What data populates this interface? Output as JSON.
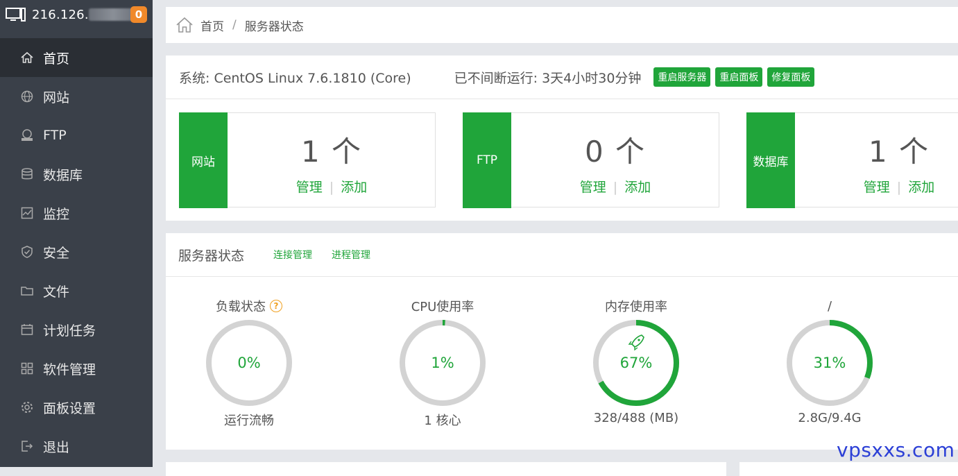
{
  "sidebar": {
    "server_ip": "216.126.",
    "notification_count": "0",
    "items": [
      {
        "label": "首页",
        "icon": "home-icon",
        "active": true
      },
      {
        "label": "网站",
        "icon": "globe-icon"
      },
      {
        "label": "FTP",
        "icon": "ftp-icon"
      },
      {
        "label": "数据库",
        "icon": "database-icon"
      },
      {
        "label": "监控",
        "icon": "monitor-icon"
      },
      {
        "label": "安全",
        "icon": "shield-icon"
      },
      {
        "label": "文件",
        "icon": "folder-icon"
      },
      {
        "label": "计划任务",
        "icon": "calendar-icon"
      },
      {
        "label": "软件管理",
        "icon": "apps-grid-icon"
      },
      {
        "label": "面板设置",
        "icon": "gear-icon"
      },
      {
        "label": "退出",
        "icon": "logout-icon"
      }
    ]
  },
  "breadcrumb": {
    "home": "首页",
    "separator": "/",
    "current": "服务器状态"
  },
  "system": {
    "os": "系统: CentOS Linux 7.6.1810 (Core)",
    "uptime": "已不间断运行: 3天4小时30分钟",
    "buttons": {
      "restart_server": "重启服务器",
      "restart_panel": "重启面板",
      "repair_panel": "修复面板"
    }
  },
  "cards": [
    {
      "tag": "网站",
      "count": "1 个",
      "manage": "管理",
      "add": "添加"
    },
    {
      "tag": "FTP",
      "count": "0 个",
      "manage": "管理",
      "add": "添加"
    },
    {
      "tag": "数据库",
      "count": "1 个",
      "manage": "管理",
      "add": "添加"
    }
  ],
  "status": {
    "title": "服务器状态",
    "tabs": {
      "connections": "连接管理",
      "processes": "进程管理"
    },
    "gauges": [
      {
        "title": "负载状态",
        "value": "0%",
        "percent": 0,
        "subtitle": "运行流畅",
        "help": "?"
      },
      {
        "title": "CPU使用率",
        "value": "1%",
        "percent": 1,
        "subtitle": "1 核心"
      },
      {
        "title": "内存使用率",
        "value": "67%",
        "percent": 67,
        "subtitle": "328/488 (MB)"
      },
      {
        "title": "/",
        "value": "31%",
        "percent": 31,
        "subtitle": "2.8G/9.4G"
      }
    ]
  },
  "colors": {
    "accent": "#20a53a",
    "sidebar": "#3a4049",
    "badge": "#f0892a",
    "ring_track": "#d3d3d3"
  },
  "watermark": "vpsxxs.com"
}
